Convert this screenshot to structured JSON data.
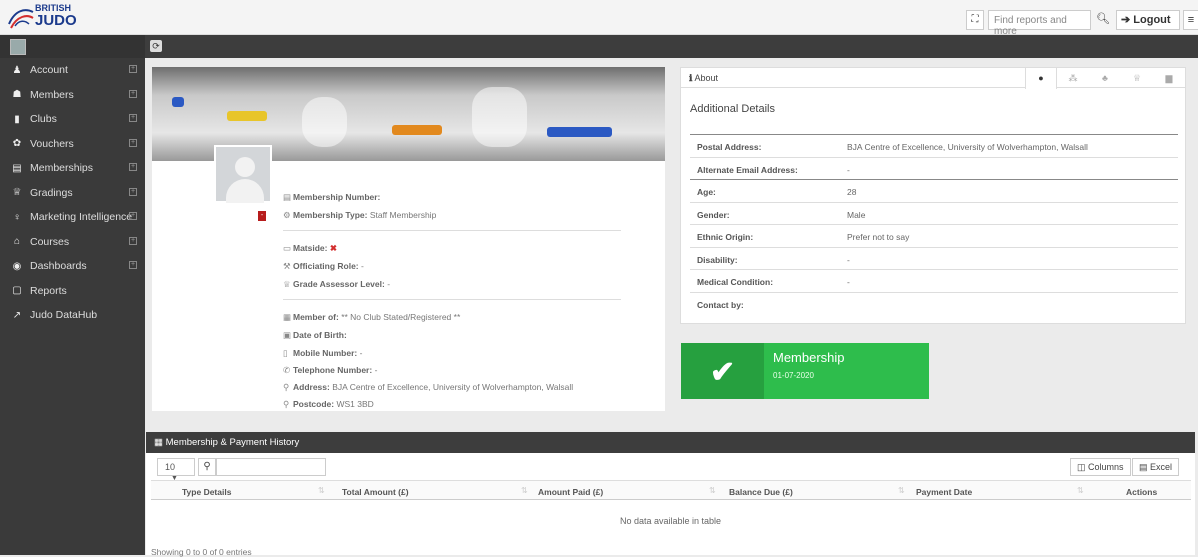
{
  "brand": {
    "line1": "BRITISH",
    "line2": "JUDO"
  },
  "topbar": {
    "search_placeholder": "Find reports and more",
    "logout_label": "Logout"
  },
  "sidebar": {
    "items": [
      {
        "label": "Account",
        "icon": "user-icon",
        "expandable": true
      },
      {
        "label": "Members",
        "icon": "users-icon",
        "expandable": true
      },
      {
        "label": "Clubs",
        "icon": "building-icon",
        "expandable": true
      },
      {
        "label": "Vouchers",
        "icon": "gift-icon",
        "expandable": true
      },
      {
        "label": "Memberships",
        "icon": "id-card-icon",
        "expandable": true
      },
      {
        "label": "Gradings",
        "icon": "trophy-icon",
        "expandable": true
      },
      {
        "label": "Marketing Intelligence",
        "icon": "lightbulb-icon",
        "expandable": true
      },
      {
        "label": "Courses",
        "icon": "graduation-cap-icon",
        "expandable": true
      },
      {
        "label": "Dashboards",
        "icon": "dashboard-icon",
        "expandable": true
      },
      {
        "label": "Reports",
        "icon": "file-icon",
        "expandable": false
      },
      {
        "label": "Judo DataHub",
        "icon": "external-link-icon",
        "expandable": false
      }
    ]
  },
  "profile": {
    "membership_number_label": "Membership Number:",
    "membership_number": "",
    "membership_type_label": "Membership Type:",
    "membership_type": "Staff Membership",
    "matside_label": "Matside:",
    "matside": "✖",
    "officiating_role_label": "Officiating Role:",
    "officiating_role": "-",
    "grade_assessor_label": "Grade Assessor Level:",
    "grade_assessor": "-",
    "member_of_label": "Member of:",
    "member_of": "** No Club Stated/Registered **",
    "dob_label": "Date of Birth:",
    "dob": "",
    "mobile_label": "Mobile Number:",
    "mobile": "-",
    "telephone_label": "Telephone Number:",
    "telephone": "-",
    "address_label": "Address:",
    "address": "BJA Centre of Excellence, University of Wolverhampton, Walsall",
    "postcode_label": "Postcode:",
    "postcode": "WS1 3BD"
  },
  "about": {
    "header": "About",
    "section_title": "Additional Details",
    "rows": [
      {
        "k": "Postal Address:",
        "v": "BJA Centre of Excellence, University of Wolverhampton, Walsall"
      },
      {
        "k": "Alternate Email Address:",
        "v": "-"
      },
      {
        "k": "Age:",
        "v": "28"
      },
      {
        "k": "Gender:",
        "v": "Male"
      },
      {
        "k": "Ethnic Origin:",
        "v": "Prefer not to say"
      },
      {
        "k": "Disability:",
        "v": "-"
      },
      {
        "k": "Medical Condition:",
        "v": "-"
      },
      {
        "k": "Contact by:",
        "v": ""
      }
    ]
  },
  "membership_tile": {
    "title": "Membership",
    "date": "01-07-2020",
    "color": "#2ebd4c"
  },
  "history": {
    "title": "Membership & Payment History",
    "page_length": "10",
    "columns_label": "Columns",
    "excel_label": "Excel",
    "headers": [
      "Type Details",
      "Total Amount (£)",
      "Amount Paid (£)",
      "Balance Due (£)",
      "Payment Date",
      "Actions"
    ],
    "empty_text": "No data available in table",
    "showing": "Showing 0 to 0 of 0 entries"
  }
}
